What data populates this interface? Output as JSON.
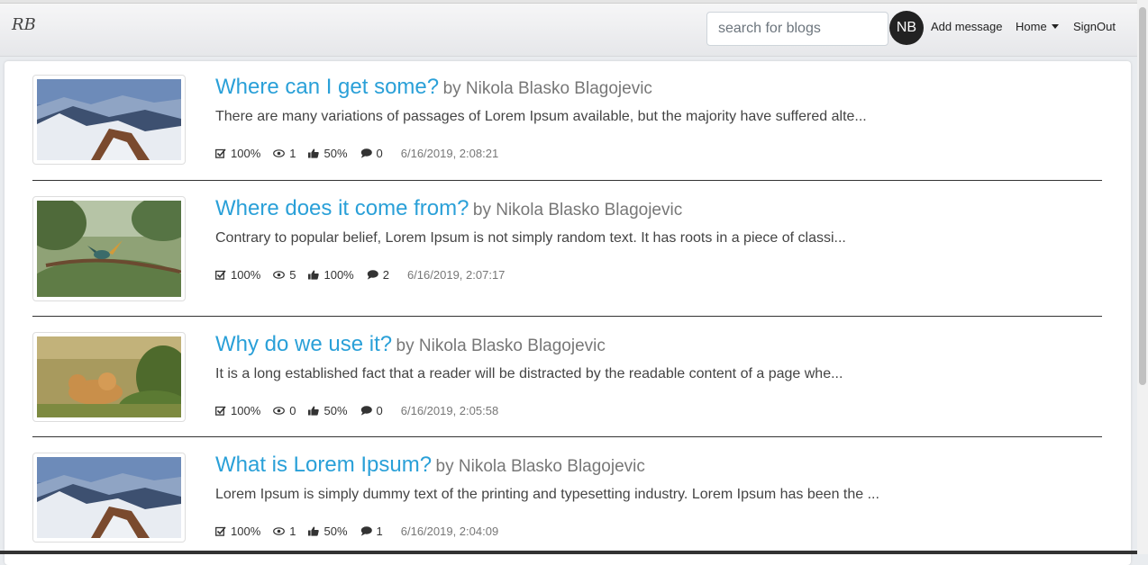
{
  "brand": "RB",
  "search": {
    "placeholder": "search for blogs"
  },
  "nav": {
    "avatar_initials": "NB",
    "add_message": "Add message",
    "home": "Home",
    "signout": "SignOut"
  },
  "posts": [
    {
      "title": "Where can I get some?",
      "author": "by Nikola Blasko Blagojevic",
      "excerpt": "There are many variations of passages of Lorem Ipsum available, but the majority have suffered alte...",
      "rating": "100%",
      "views": "1",
      "likes": "50%",
      "comments": "0",
      "date": "6/16/2019, 2:08:21",
      "image": "mountain-image"
    },
    {
      "title": "Where does it come from?",
      "author": "by Nikola Blasko Blagojevic",
      "excerpt": "Contrary to popular belief, Lorem Ipsum is not simply random text. It has roots in a piece of classi...",
      "rating": "100%",
      "views": "5",
      "likes": "100%",
      "comments": "2",
      "date": "6/16/2019, 2:07:17",
      "image": "bird-image"
    },
    {
      "title": "Why do we use it?",
      "author": "by Nikola Blasko Blagojevic",
      "excerpt": "It is a long established fact that a reader will be distracted by the readable content of a page whe...",
      "rating": "100%",
      "views": "0",
      "likes": "50%",
      "comments": "0",
      "date": "6/16/2019, 2:05:58",
      "image": "lion-cubs-image"
    },
    {
      "title": "What is Lorem Ipsum?",
      "author": "by Nikola Blasko Blagojevic",
      "excerpt": "Lorem Ipsum is simply dummy text of the printing and typesetting industry. Lorem Ipsum has been the ...",
      "rating": "100%",
      "views": "1",
      "likes": "50%",
      "comments": "1",
      "date": "6/16/2019, 2:04:09",
      "image": "mountain-image"
    }
  ],
  "colors": {
    "link": "#2aa0d8",
    "author": "#777777",
    "navbar": "#e9eaed"
  }
}
